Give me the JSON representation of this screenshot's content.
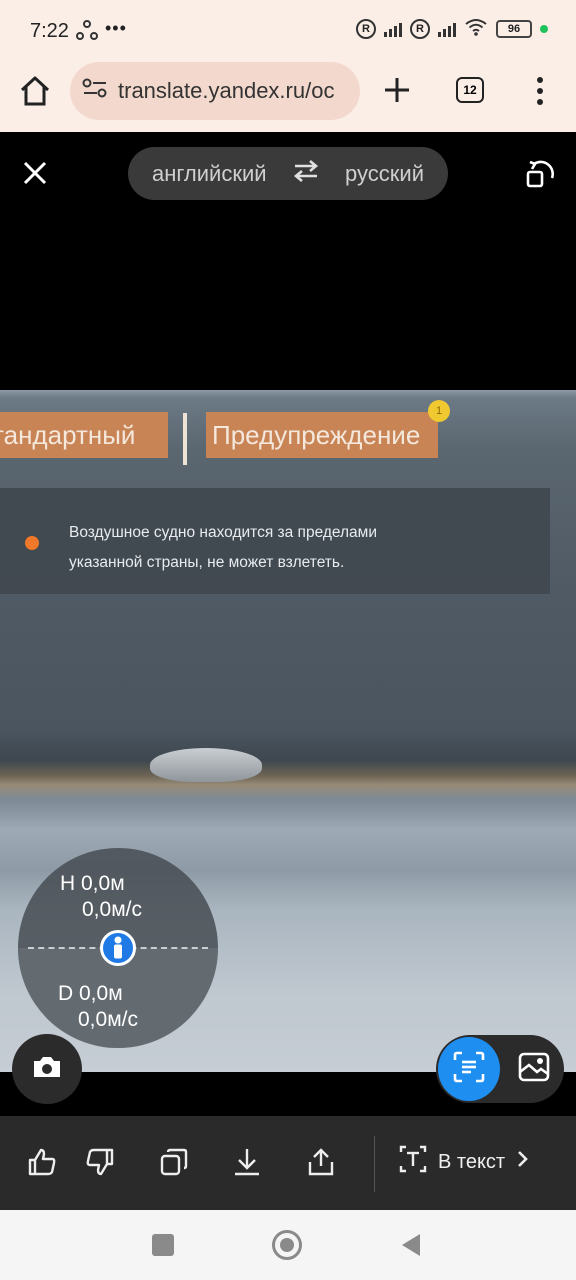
{
  "status_bar": {
    "time": "7:22",
    "more": "•••",
    "sim1_badge": "R",
    "sim2_badge": "R",
    "battery": "96"
  },
  "browser": {
    "url": "translate.yandex.ru/oc",
    "tab_count": "12"
  },
  "translator": {
    "source_lang": "английский",
    "target_lang": "русский"
  },
  "photo": {
    "tab_standard": "тандартный",
    "tab_warning": "Предупреждение",
    "warning_badge": "1",
    "message_line1": "Воздушное судно находится за пределами",
    "message_line2": "указанной страны, не может взлететь.",
    "height_value": "H 0,0м",
    "height_speed": "0,0м/с",
    "distance_value": "D 0,0м",
    "distance_speed": "0,0м/с"
  },
  "actions": {
    "to_text_label": "В текст"
  },
  "colors": {
    "accent_blue": "#1f8ef1",
    "warning_orange": "#c98456",
    "status_dot_green": "#1fc25b"
  }
}
